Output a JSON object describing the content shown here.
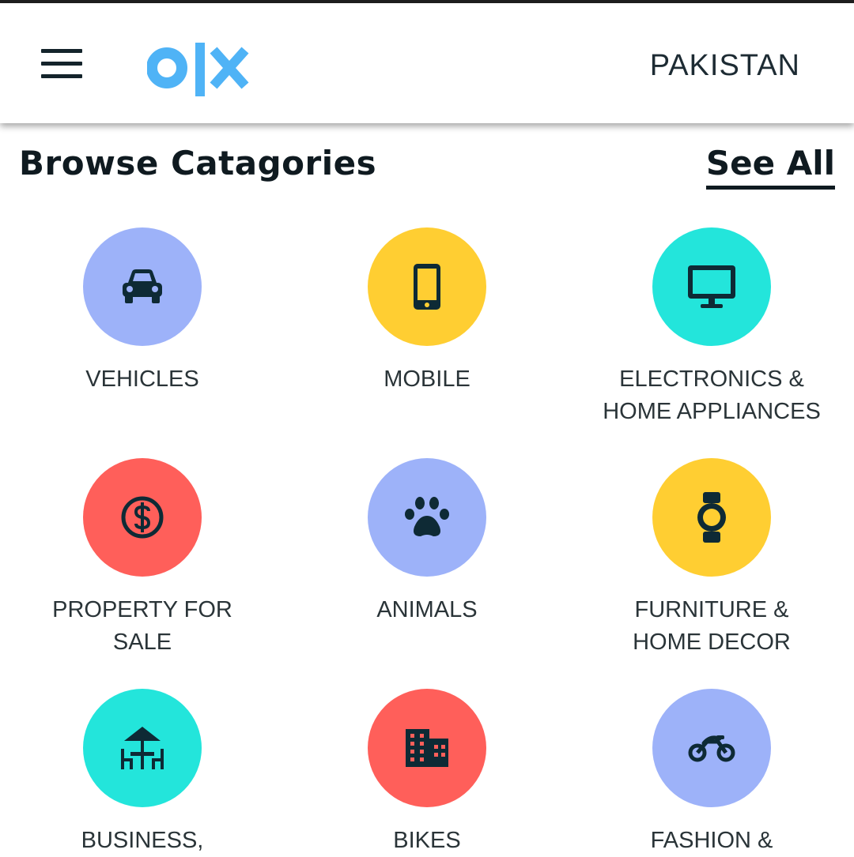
{
  "header": {
    "menu_icon": "hamburger-menu-icon",
    "logo_text": "olx",
    "country": "PAKISTAN"
  },
  "browse": {
    "title": "Browse Catagories",
    "see_all": "See All"
  },
  "colors": {
    "periwinkle": "#9db2f9",
    "yellow": "#ffce32",
    "teal": "#23e5db",
    "coral": "#ff5f5a",
    "logo_blue": "#4fb3f6",
    "icon_dark": "#0e2a35"
  },
  "categories": [
    {
      "label": "VEHICLES",
      "icon": "car-icon",
      "color": "#9db2f9"
    },
    {
      "label": "MOBILE",
      "icon": "mobile-phone-icon",
      "color": "#ffce32"
    },
    {
      "label": "ELECTRONICS &\nHOME APPLIANCES",
      "icon": "monitor-icon",
      "color": "#23e5db"
    },
    {
      "label": "PROPERTY FOR\nSALE",
      "icon": "dollar-icon",
      "color": "#ff5f5a"
    },
    {
      "label": "ANIMALS",
      "icon": "paw-icon",
      "color": "#9db2f9"
    },
    {
      "label": "FURNITURE &\nHOME DECOR",
      "icon": "watch-icon",
      "color": "#ffce32"
    },
    {
      "label": "BUSINESS,",
      "icon": "furniture-table-icon",
      "color": "#23e5db"
    },
    {
      "label": "BIKES",
      "icon": "building-icon",
      "color": "#ff5f5a"
    },
    {
      "label": "FASHION &",
      "icon": "motorbike-icon",
      "color": "#9db2f9"
    }
  ]
}
